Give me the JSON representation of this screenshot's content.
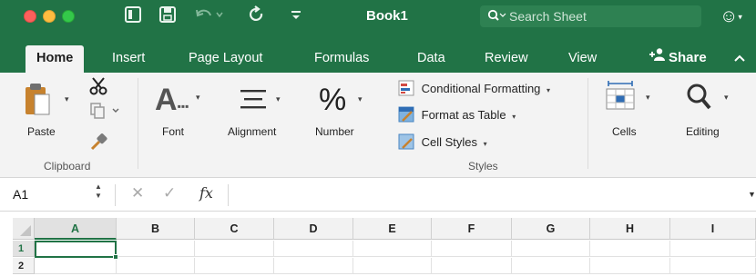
{
  "window": {
    "title": "Book1",
    "search_placeholder": "Search Sheet",
    "account_icon": "smiley-icon"
  },
  "tabs": [
    {
      "label": "Home",
      "active": true
    },
    {
      "label": "Insert"
    },
    {
      "label": "Page Layout"
    },
    {
      "label": "Formulas"
    },
    {
      "label": "Data"
    },
    {
      "label": "Review"
    },
    {
      "label": "View"
    }
  ],
  "share_label": "Share",
  "ribbon": {
    "paste": "Paste",
    "clipboard": "Clipboard",
    "font": "Font",
    "alignment": "Alignment",
    "number": "Number",
    "styles": {
      "conditional_formatting": "Conditional Formatting",
      "format_as_table": "Format as Table",
      "cell_styles": "Cell Styles",
      "group": "Styles"
    },
    "cells": "Cells",
    "editing": "Editing"
  },
  "formula_bar": {
    "name_box": "A1",
    "fx": "fx",
    "formula": ""
  },
  "grid": {
    "columns": [
      "A",
      "B",
      "C",
      "D",
      "E",
      "F",
      "G",
      "H",
      "I"
    ],
    "rows": [
      "1",
      "2"
    ],
    "selected_cell": "A1"
  },
  "colors": {
    "accent": "#217346",
    "ribbon_bg": "#f3f3f3"
  }
}
